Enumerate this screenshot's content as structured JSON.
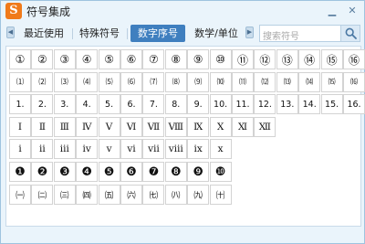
{
  "window": {
    "title": "符号集成",
    "icon_glyph": "S",
    "icon_name": "sogou-s-icon",
    "minimize_glyph": "▁",
    "close_glyph": "✕"
  },
  "tabs": [
    {
      "label": "最近使用",
      "active": false
    },
    {
      "label": "特殊符号",
      "active": false
    },
    {
      "label": "数字序号",
      "active": true
    },
    {
      "label": "数学/单位",
      "active": false
    }
  ],
  "tab_arrow_left": "◀",
  "tab_arrow_right": "▶",
  "search": {
    "placeholder": "搜索符号",
    "icon": "search-icon"
  },
  "colors": {
    "accent": "#3f7fbf",
    "border": "#9fc4df",
    "background": "#eaf4fb"
  },
  "grid": {
    "rows": [
      {
        "type": "circled",
        "symbols": [
          "①",
          "②",
          "③",
          "④",
          "⑤",
          "⑥",
          "⑦",
          "⑧",
          "⑨",
          "⑩",
          "⑪",
          "⑫",
          "⑬",
          "⑭",
          "⑮",
          "⑯"
        ]
      },
      {
        "type": "paren",
        "symbols": [
          "⑴",
          "⑵",
          "⑶",
          "⑷",
          "⑸",
          "⑹",
          "⑺",
          "⑻",
          "⑼",
          "⑽",
          "⑾",
          "⑿",
          "⒀",
          "⒁",
          "⒂",
          "⒃"
        ]
      },
      {
        "type": "period",
        "symbols": [
          "1.",
          "2.",
          "3.",
          "4.",
          "5.",
          "6.",
          "7.",
          "8.",
          "9.",
          "10.",
          "11.",
          "12.",
          "13.",
          "14.",
          "15.",
          "16."
        ]
      },
      {
        "type": "roman-up",
        "symbols": [
          "Ⅰ",
          "Ⅱ",
          "Ⅲ",
          "Ⅳ",
          "Ⅴ",
          "Ⅵ",
          "Ⅶ",
          "Ⅷ",
          "Ⅸ",
          "Ⅹ",
          "Ⅺ",
          "Ⅻ"
        ]
      },
      {
        "type": "roman-lo",
        "symbols": [
          "ⅰ",
          "ⅱ",
          "ⅲ",
          "ⅳ",
          "ⅴ",
          "ⅵ",
          "ⅶ",
          "ⅷ",
          "ⅸ",
          "ⅹ"
        ]
      },
      {
        "type": "negative",
        "symbols": [
          "❶",
          "❷",
          "❸",
          "❹",
          "❺",
          "❻",
          "❼",
          "❽",
          "❾",
          "❿"
        ]
      },
      {
        "type": "paren-cjk",
        "symbols": [
          "㈠",
          "㈡",
          "㈢",
          "㈣",
          "㈤",
          "㈥",
          "㈦",
          "㈧",
          "㈨",
          "㈩"
        ]
      }
    ]
  }
}
